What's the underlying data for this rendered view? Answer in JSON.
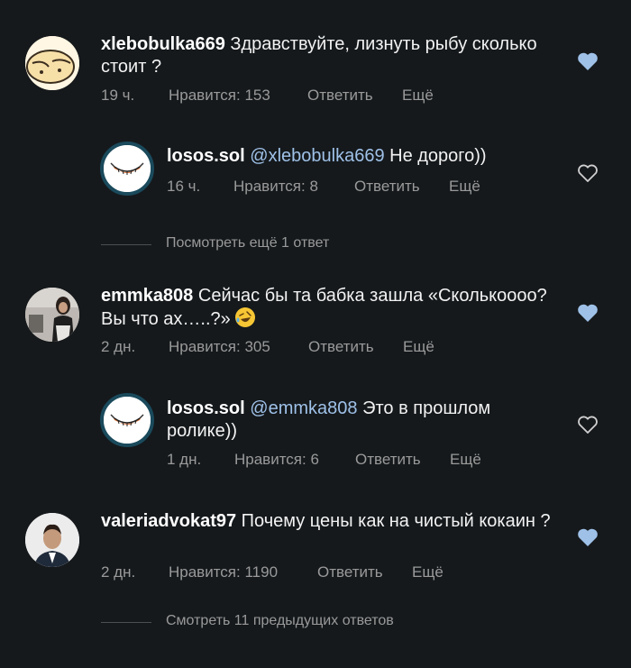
{
  "comments": [
    {
      "username": "xlebobulka669",
      "text": "Здравствуйте, лизнуть рыбу  сколько стоит ?",
      "time": "19 ч.",
      "likes": "Нравится: 153",
      "reply": "Ответить",
      "more": "Ещё",
      "liked": true
    },
    {
      "username": "losos.sol",
      "mention": "@xlebobulka669",
      "text": "Не дорого))",
      "time": "16 ч.",
      "likes": "Нравится: 8",
      "reply": "Ответить",
      "more": "Ещё",
      "liked": false
    },
    {
      "username": "emmka808",
      "text": "Сейчас бы та бабка зашла «Сколькоооо? Вы что ах…..?»",
      "time": "2 дн.",
      "likes": "Нравится: 305",
      "reply": "Ответить",
      "more": "Ещё",
      "liked": true
    },
    {
      "username": "losos.sol",
      "mention": "@emmka808",
      "text": "Это в прошлом ролике))",
      "time": "1 дн.",
      "likes": "Нравится: 6",
      "reply": "Ответить",
      "more": "Ещё",
      "liked": false
    },
    {
      "username": "valeriadvokat97",
      "text": "Почему цены как на чистый кокаин ?",
      "time": "2 дн.",
      "likes": "Нравится: 1190",
      "reply": "Ответить",
      "more": "Ещё",
      "liked": true
    }
  ],
  "view_more_1": "Посмотреть ещё 1 ответ",
  "view_more_2": "Смотреть 11 предыдущих ответов",
  "colors": {
    "background": "#15191c",
    "liked_heart": "#9fc1e8",
    "mention": "#9fc1e8",
    "meta": "#9a9a9a"
  },
  "icons": [
    "heart-filled-icon",
    "heart-outline-icon",
    "rofl-emoji-icon"
  ]
}
